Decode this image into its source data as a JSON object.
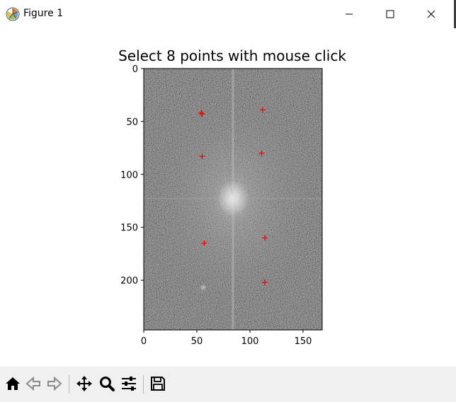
{
  "window": {
    "title": "Figure 1",
    "icons": [
      "matplotlib-icon",
      "minimize-icon",
      "maximize-icon",
      "close-icon"
    ]
  },
  "figure": {
    "title": "Select 8 points with mouse click"
  },
  "chart_data": {
    "type": "scatter",
    "image": "grayscale Fourier spectrum (imshow)",
    "title": "Select 8 points with mouse click",
    "xlim": [
      0,
      168
    ],
    "ylim": [
      247,
      0
    ],
    "x_ticks": [
      0,
      50,
      100,
      150
    ],
    "y_ticks": [
      0,
      50,
      100,
      150,
      200
    ],
    "marker": "+",
    "marker_color": "#ff0000",
    "points": [
      {
        "x": 54,
        "y": 42
      },
      {
        "x": 112,
        "y": 39
      },
      {
        "x": 55,
        "y": 83
      },
      {
        "x": 111,
        "y": 80
      },
      {
        "x": 57,
        "y": 165
      },
      {
        "x": 114,
        "y": 160
      },
      {
        "x": 114,
        "y": 202
      },
      {
        "x": 55,
        "y": 43
      }
    ],
    "grid": false
  },
  "toolbar": {
    "buttons": [
      "home-icon",
      "back-icon",
      "forward-icon",
      "pan-icon",
      "zoom-icon",
      "configure-subplots-icon",
      "save-icon"
    ]
  },
  "colors": {
    "toolbar_bg": "#f0f0f0",
    "marker": "#ff0000",
    "spectrum_base": "#6e6e6e"
  }
}
